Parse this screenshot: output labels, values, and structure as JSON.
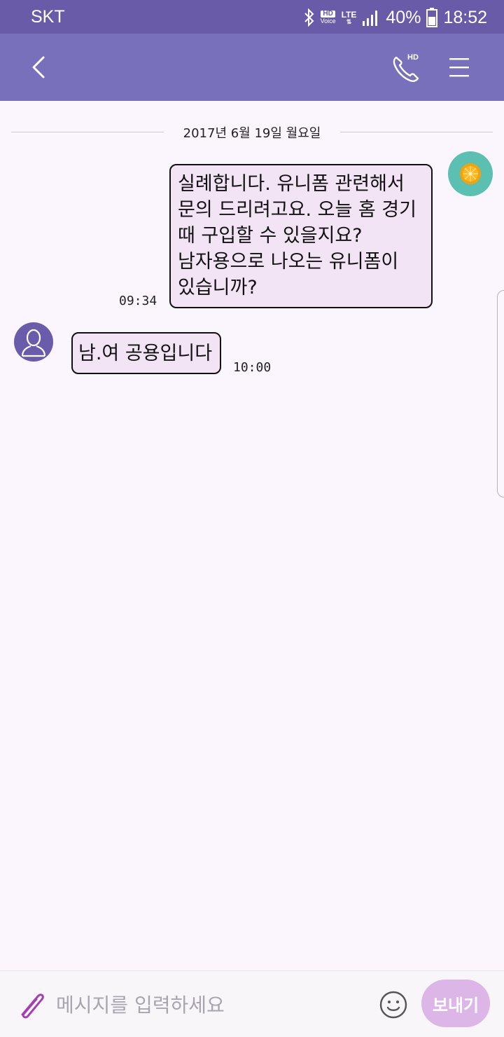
{
  "status_bar": {
    "carrier": "SKT",
    "hd_label": "HD",
    "voice_label": "Voice",
    "lte_label": "LTE",
    "battery_percent": "40%",
    "time": "18:52"
  },
  "app_bar": {
    "call_badge": "HD",
    "icons": [
      "back-arrow-icon",
      "hd-call-icon",
      "menu-icon"
    ],
    "color": "#7870bb"
  },
  "conversation": {
    "date_separator": "2017년 6월 19일 월요일",
    "messages": [
      {
        "direction": "outgoing",
        "lines": [
          "실례합니다. 유니폼 관련해서",
          "문의 드리려고요. 오늘 홈 경기",
          "때 구입할 수 있을지요?",
          "남자용으로 나오는 유니폼이",
          "있습니까?"
        ],
        "time": "09:34"
      },
      {
        "direction": "incoming",
        "lines": [
          "남.여 공용입니다"
        ],
        "time": "10:00"
      }
    ]
  },
  "composer": {
    "placeholder": "메시지를 입력하세요",
    "value": "",
    "send_label": "보내기"
  },
  "colors": {
    "status_bar": "#6a5ba9",
    "app_bar": "#7870bb",
    "background": "#fbf5fd",
    "bubble": "#f2e3f5",
    "send_button": "#dcb6e6",
    "my_avatar": "#5bbfb1",
    "other_avatar": "#6b5bab"
  }
}
